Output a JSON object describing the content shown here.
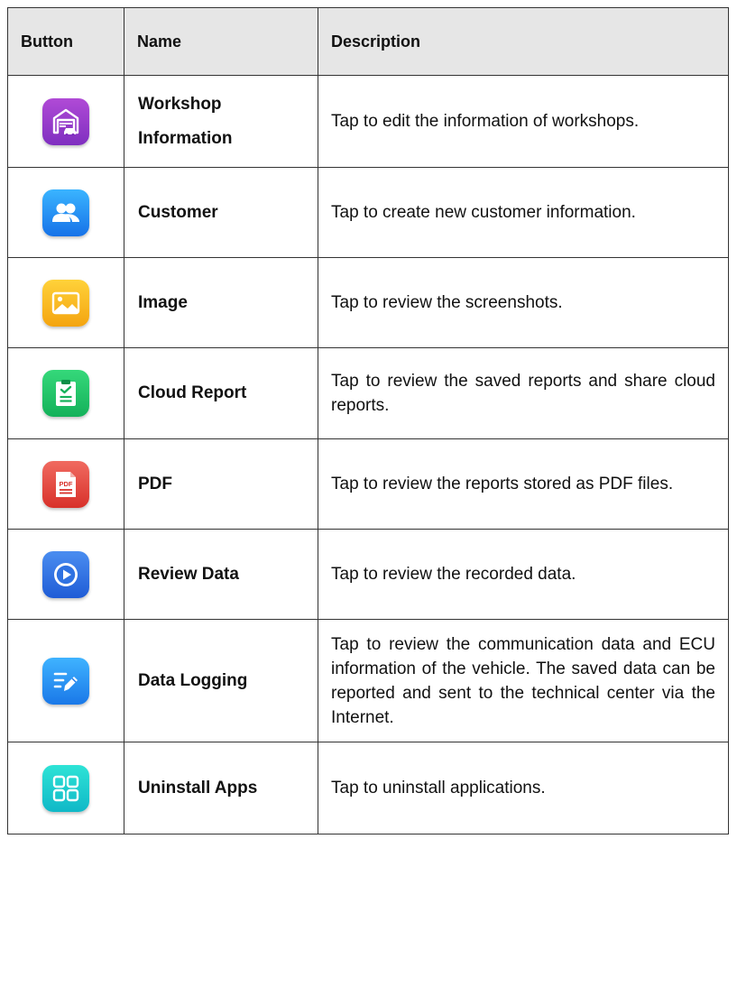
{
  "table": {
    "headers": [
      "Button",
      "Name",
      "Description"
    ],
    "rows": [
      {
        "icon": "workshop-icon",
        "name_lines": [
          "Workshop",
          "Information"
        ],
        "description": "Tap to edit the information of workshops."
      },
      {
        "icon": "customer-icon",
        "name": "Customer",
        "description": "Tap to create new customer information."
      },
      {
        "icon": "image-icon",
        "name": "Image",
        "description": "Tap to review the screenshots."
      },
      {
        "icon": "cloud-report-icon",
        "name": "Cloud Report",
        "description": "Tap to review the saved reports and share cloud reports."
      },
      {
        "icon": "pdf-icon",
        "name": "PDF",
        "description": "Tap to review the reports stored as PDF files.",
        "icon_text": "PDF"
      },
      {
        "icon": "review-data-icon",
        "name": "Review Data",
        "description": "Tap to review the recorded data."
      },
      {
        "icon": "data-logging-icon",
        "name": "Data Logging",
        "description": "Tap to review the communication data and ECU information of the vehicle. The saved data can be reported and sent to the technical center via the Internet."
      },
      {
        "icon": "uninstall-apps-icon",
        "name": "Uninstall Apps",
        "description": "Tap to uninstall applications."
      }
    ]
  },
  "colors": {
    "header_bg": "#e6e6e6",
    "border": "#333333",
    "workshop": "#9a3bcf",
    "customer": "#1f8df5",
    "image": "#f8bb1e",
    "cloud": "#1fc466",
    "pdf": "#e24a40",
    "review": "#2f72e2",
    "logging": "#2393f3",
    "uninstall": "#1ccfd0"
  }
}
